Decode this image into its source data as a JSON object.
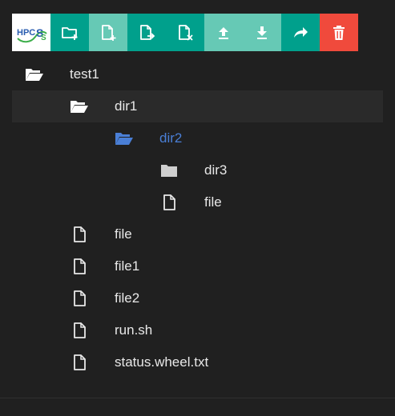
{
  "app": {
    "logo_text": "HPCSS"
  },
  "colors": {
    "toolbar_teal": "#00a08c",
    "toolbar_teal_light": "#66c9b5",
    "toolbar_delete": "#f04a3c",
    "selected_row": "#2a2a2a",
    "active_text": "#4a7fd6",
    "background": "#202020"
  },
  "toolbar": {
    "buttons": [
      {
        "name": "new-folder",
        "icon": "folder-plus-icon"
      },
      {
        "name": "new-file",
        "icon": "file-plus-icon"
      },
      {
        "name": "move-file",
        "icon": "file-move-icon"
      },
      {
        "name": "remove-file",
        "icon": "file-x-icon"
      },
      {
        "name": "upload",
        "icon": "upload-icon"
      },
      {
        "name": "download",
        "icon": "download-icon"
      },
      {
        "name": "share",
        "icon": "share-icon"
      },
      {
        "name": "delete",
        "icon": "trash-icon"
      }
    ]
  },
  "tree": {
    "items": [
      {
        "label": "test1",
        "type": "folder-open",
        "depth": 0
      },
      {
        "label": "dir1",
        "type": "folder-open",
        "depth": 1,
        "selected": true
      },
      {
        "label": "dir2",
        "type": "folder-open",
        "depth": 2,
        "active": true
      },
      {
        "label": "dir3",
        "type": "folder",
        "depth": 3
      },
      {
        "label": "file",
        "type": "file",
        "depth": 3
      },
      {
        "label": "file",
        "type": "file",
        "depth": 1
      },
      {
        "label": "file1",
        "type": "file",
        "depth": 1
      },
      {
        "label": "file2",
        "type": "file",
        "depth": 1
      },
      {
        "label": "run.sh",
        "type": "file",
        "depth": 1
      },
      {
        "label": "status.wheel.txt",
        "type": "file",
        "depth": 1
      }
    ]
  }
}
